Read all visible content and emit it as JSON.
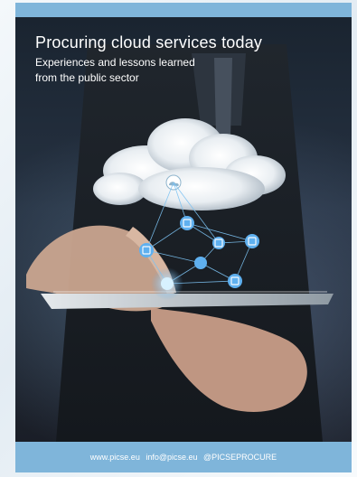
{
  "cover": {
    "title": "Procuring cloud services today",
    "subtitle_line1": "Experiences and lessons learned",
    "subtitle_line2": "from the public sector"
  },
  "footer": {
    "website": "www.picse.eu",
    "email": "info@picse.eu",
    "handle": "@PICSEPROCURE"
  },
  "colors": {
    "banner": "#7fb5da",
    "network": "#5fb0ef"
  },
  "icons": [
    "cloud-icon",
    "network-icon"
  ]
}
